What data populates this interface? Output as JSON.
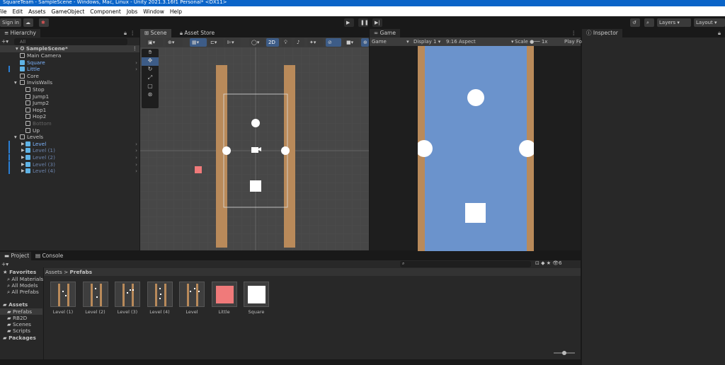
{
  "window": {
    "title": "SquareTeam - SampleScene - Windows, Mac, Linux - Unity 2021.3.16f1 Personal* <DX11>"
  },
  "menu": [
    "File",
    "Edit",
    "Assets",
    "GameObject",
    "Component",
    "Jobs",
    "Window",
    "Help"
  ],
  "toolbar": {
    "sign_in": "Sign in",
    "layers": "Layers",
    "layout": "Layout"
  },
  "hierarchy": {
    "tab": "Hierarchy",
    "search_placeholder": "All",
    "scene": "SampleScene*",
    "items": [
      {
        "label": "Main Camera",
        "indent": 1,
        "style": "normal"
      },
      {
        "label": "Square",
        "indent": 1,
        "style": "prefab"
      },
      {
        "label": "Little",
        "indent": 1,
        "style": "prefab"
      },
      {
        "label": "Core",
        "indent": 1,
        "style": "normal"
      },
      {
        "label": "InvisWalls",
        "indent": 1,
        "style": "normal",
        "expanded": true
      },
      {
        "label": "Stop",
        "indent": 2,
        "style": "normal"
      },
      {
        "label": "Jump1",
        "indent": 2,
        "style": "normal"
      },
      {
        "label": "Jump2",
        "indent": 2,
        "style": "normal"
      },
      {
        "label": "Hop1",
        "indent": 2,
        "style": "normal"
      },
      {
        "label": "Hop2",
        "indent": 2,
        "style": "normal"
      },
      {
        "label": "Bottom",
        "indent": 2,
        "style": "disabled"
      },
      {
        "label": "Up",
        "indent": 2,
        "style": "normal"
      },
      {
        "label": "Levels",
        "indent": 1,
        "style": "normal",
        "expanded": true
      },
      {
        "label": "Level",
        "indent": 2,
        "style": "prefab"
      },
      {
        "label": "Level (1)",
        "indent": 2,
        "style": "prefab-dim"
      },
      {
        "label": "Level (2)",
        "indent": 2,
        "style": "prefab-dim"
      },
      {
        "label": "Level (3)",
        "indent": 2,
        "style": "prefab-dim"
      },
      {
        "label": "Level (4)",
        "indent": 2,
        "style": "prefab-dim"
      }
    ]
  },
  "scene": {
    "tab": "Scene",
    "asset_store_tab": "Asset Store",
    "mode_2d": "2D"
  },
  "game": {
    "tab": "Game",
    "view": "Game",
    "display": "Display 1",
    "aspect": "9:16 Aspect",
    "scale_label": "Scale",
    "scale_value": "1x",
    "play_focused": "Play Fo"
  },
  "inspector": {
    "tab": "Inspector"
  },
  "project": {
    "tab": "Project",
    "console_tab": "Console",
    "hidden_count": "6",
    "favorites": {
      "label": "Favorites",
      "items": [
        "All Materials",
        "All Models",
        "All Prefabs"
      ]
    },
    "assets": {
      "label": "Assets",
      "items": [
        "Prefabs",
        "RB2D",
        "Scenes",
        "Scripts"
      ]
    },
    "packages": "Packages",
    "breadcrumb": [
      "Assets",
      "Prefabs"
    ],
    "files": [
      {
        "label": "Level (1)",
        "kind": "level"
      },
      {
        "label": "Level (2)",
        "kind": "level"
      },
      {
        "label": "Level (3)",
        "kind": "level"
      },
      {
        "label": "Level (4)",
        "kind": "level"
      },
      {
        "label": "Level",
        "kind": "level"
      },
      {
        "label": "Little",
        "kind": "red"
      },
      {
        "label": "Square",
        "kind": "white"
      }
    ]
  },
  "colors": {
    "game_bg": "#6b93cc",
    "wall": "#b98a5a",
    "little": "#f07a7a",
    "accent": "#2a7ed4"
  }
}
